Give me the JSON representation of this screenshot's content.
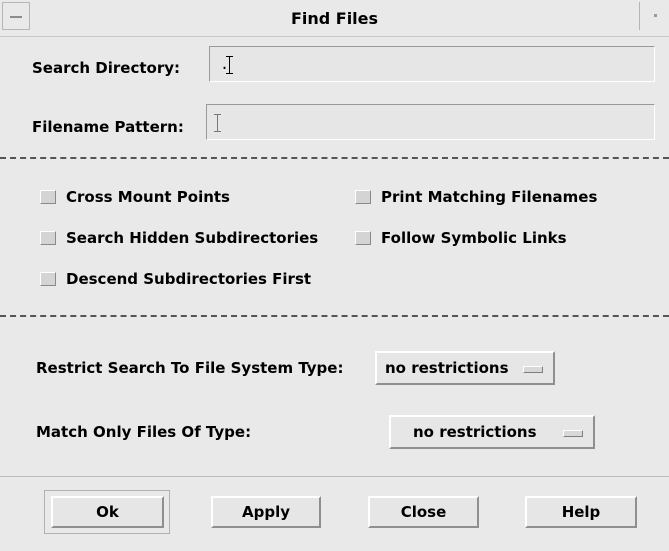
{
  "window": {
    "title": "Find Files"
  },
  "search_directory": {
    "label": "Search Directory:",
    "value": "."
  },
  "filename_pattern": {
    "label": "Filename Pattern:",
    "value": ""
  },
  "options": {
    "cross_mount_points": "Cross Mount Points",
    "print_matching_filenames": "Print Matching Filenames",
    "search_hidden_subdirectories": "Search Hidden Subdirectories",
    "follow_symbolic_links": "Follow Symbolic Links",
    "descend_subdirectories_first": "Descend Subdirectories First"
  },
  "restrict_fs_type": {
    "label": "Restrict Search To File System Type:",
    "value": "no restrictions"
  },
  "match_file_type": {
    "label": "Match Only Files Of Type:",
    "value": "no restrictions"
  },
  "buttons": {
    "ok": "Ok",
    "apply": "Apply",
    "close": "Close",
    "help": "Help"
  },
  "colors": {
    "background": "#e9e9e9",
    "field": "#e6e6e6"
  }
}
